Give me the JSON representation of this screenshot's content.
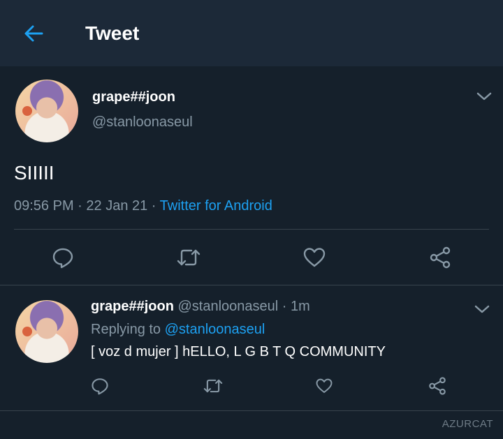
{
  "header": {
    "title": "Tweet"
  },
  "main_tweet": {
    "display_name": "grape##joon",
    "handle": "@stanloonaseul",
    "text": "SIIIII",
    "time": "09:56 PM",
    "date": "22 Jan 21",
    "source": "Twitter for Android",
    "separator": " · "
  },
  "reply": {
    "display_name": "grape##joon",
    "handle": "@stanloonaseul",
    "age": "1m",
    "dot": " · ",
    "replying_prefix": "Replying to ",
    "replying_to": "@stanloonaseul",
    "text": "[ voz d mujer ] hELLO, L G B T Q COMMUNITY"
  },
  "watermark": "AZURCAT",
  "colors": {
    "background": "#15202b",
    "header": "#1c2938",
    "accent": "#1da1f2",
    "secondary_text": "#8899a6",
    "divider": "#38444d"
  },
  "icons": {
    "back": "arrow-left-icon",
    "more": "chevron-down-icon",
    "reply": "comment-icon",
    "retweet": "retweet-icon",
    "like": "heart-icon",
    "share": "share-icon"
  }
}
